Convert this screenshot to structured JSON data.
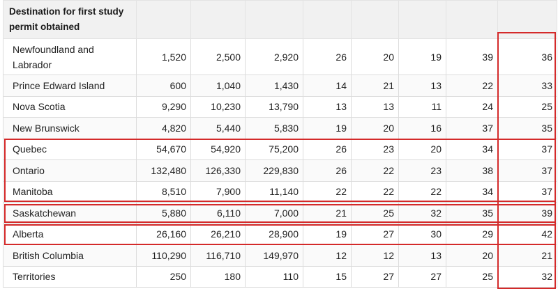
{
  "table": {
    "header": {
      "label": "Destination for first study permit obtained",
      "cols": [
        "",
        "",
        "",
        "",
        "",
        "",
        "",
        ""
      ]
    },
    "rows": [
      {
        "name": "Newfoundland and Labrador",
        "values": [
          "1,520",
          "2,500",
          "2,920",
          "26",
          "20",
          "19",
          "39",
          "36"
        ]
      },
      {
        "name": "Prince Edward Island",
        "values": [
          "600",
          "1,040",
          "1,430",
          "14",
          "21",
          "13",
          "22",
          "33"
        ]
      },
      {
        "name": "Nova Scotia",
        "values": [
          "9,290",
          "10,230",
          "13,790",
          "13",
          "13",
          "11",
          "24",
          "25"
        ]
      },
      {
        "name": "New Brunswick",
        "values": [
          "4,820",
          "5,440",
          "5,830",
          "19",
          "20",
          "16",
          "37",
          "35"
        ]
      },
      {
        "name": "Quebec",
        "values": [
          "54,670",
          "54,920",
          "75,200",
          "26",
          "23",
          "20",
          "34",
          "37"
        ]
      },
      {
        "name": "Ontario",
        "values": [
          "132,480",
          "126,330",
          "229,830",
          "26",
          "22",
          "23",
          "38",
          "37"
        ]
      },
      {
        "name": "Manitoba",
        "values": [
          "8,510",
          "7,900",
          "11,140",
          "22",
          "22",
          "22",
          "34",
          "37"
        ]
      },
      {
        "name": "Saskatchewan",
        "values": [
          "5,880",
          "6,110",
          "7,000",
          "21",
          "25",
          "32",
          "35",
          "39"
        ]
      },
      {
        "name": "Alberta",
        "values": [
          "26,160",
          "26,210",
          "28,900",
          "19",
          "27",
          "30",
          "29",
          "42"
        ]
      },
      {
        "name": "British Columbia",
        "values": [
          "110,290",
          "116,710",
          "149,970",
          "12",
          "12",
          "13",
          "20",
          "21"
        ]
      },
      {
        "name": "Territories",
        "values": [
          "250",
          "180",
          "110",
          "15",
          "27",
          "27",
          "25",
          "32"
        ]
      }
    ]
  },
  "highlight_color": "#d42a2a"
}
